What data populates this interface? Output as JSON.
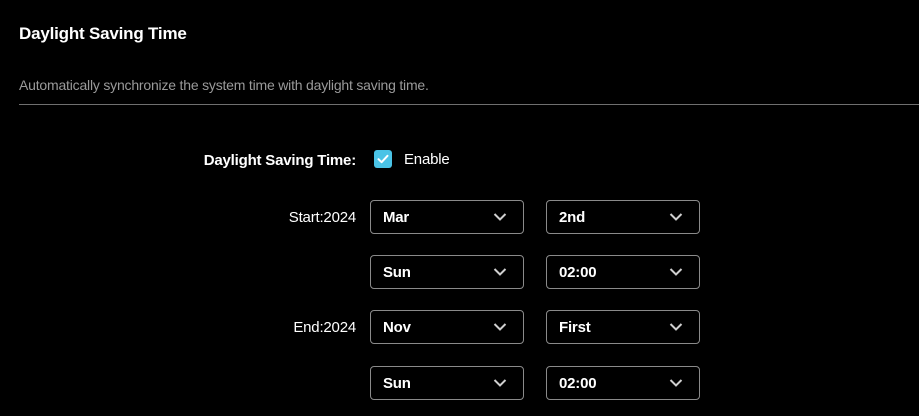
{
  "section": {
    "title": "Daylight Saving Time",
    "description": "Automatically synchronize the system time with daylight saving time."
  },
  "dst": {
    "label": "Daylight Saving Time:",
    "enable_label": "Enable",
    "enabled": true
  },
  "start": {
    "label": "Start:2024",
    "month": "Mar",
    "week": "2nd",
    "day": "Sun",
    "time": "02:00"
  },
  "end": {
    "label": "End:2024",
    "month": "Nov",
    "week": "First",
    "day": "Sun",
    "time": "02:00"
  },
  "colors": {
    "background": "#000000",
    "accent": "#4ac3e6",
    "muted_text": "#9a9a9a",
    "border": "#8a8a8a"
  }
}
